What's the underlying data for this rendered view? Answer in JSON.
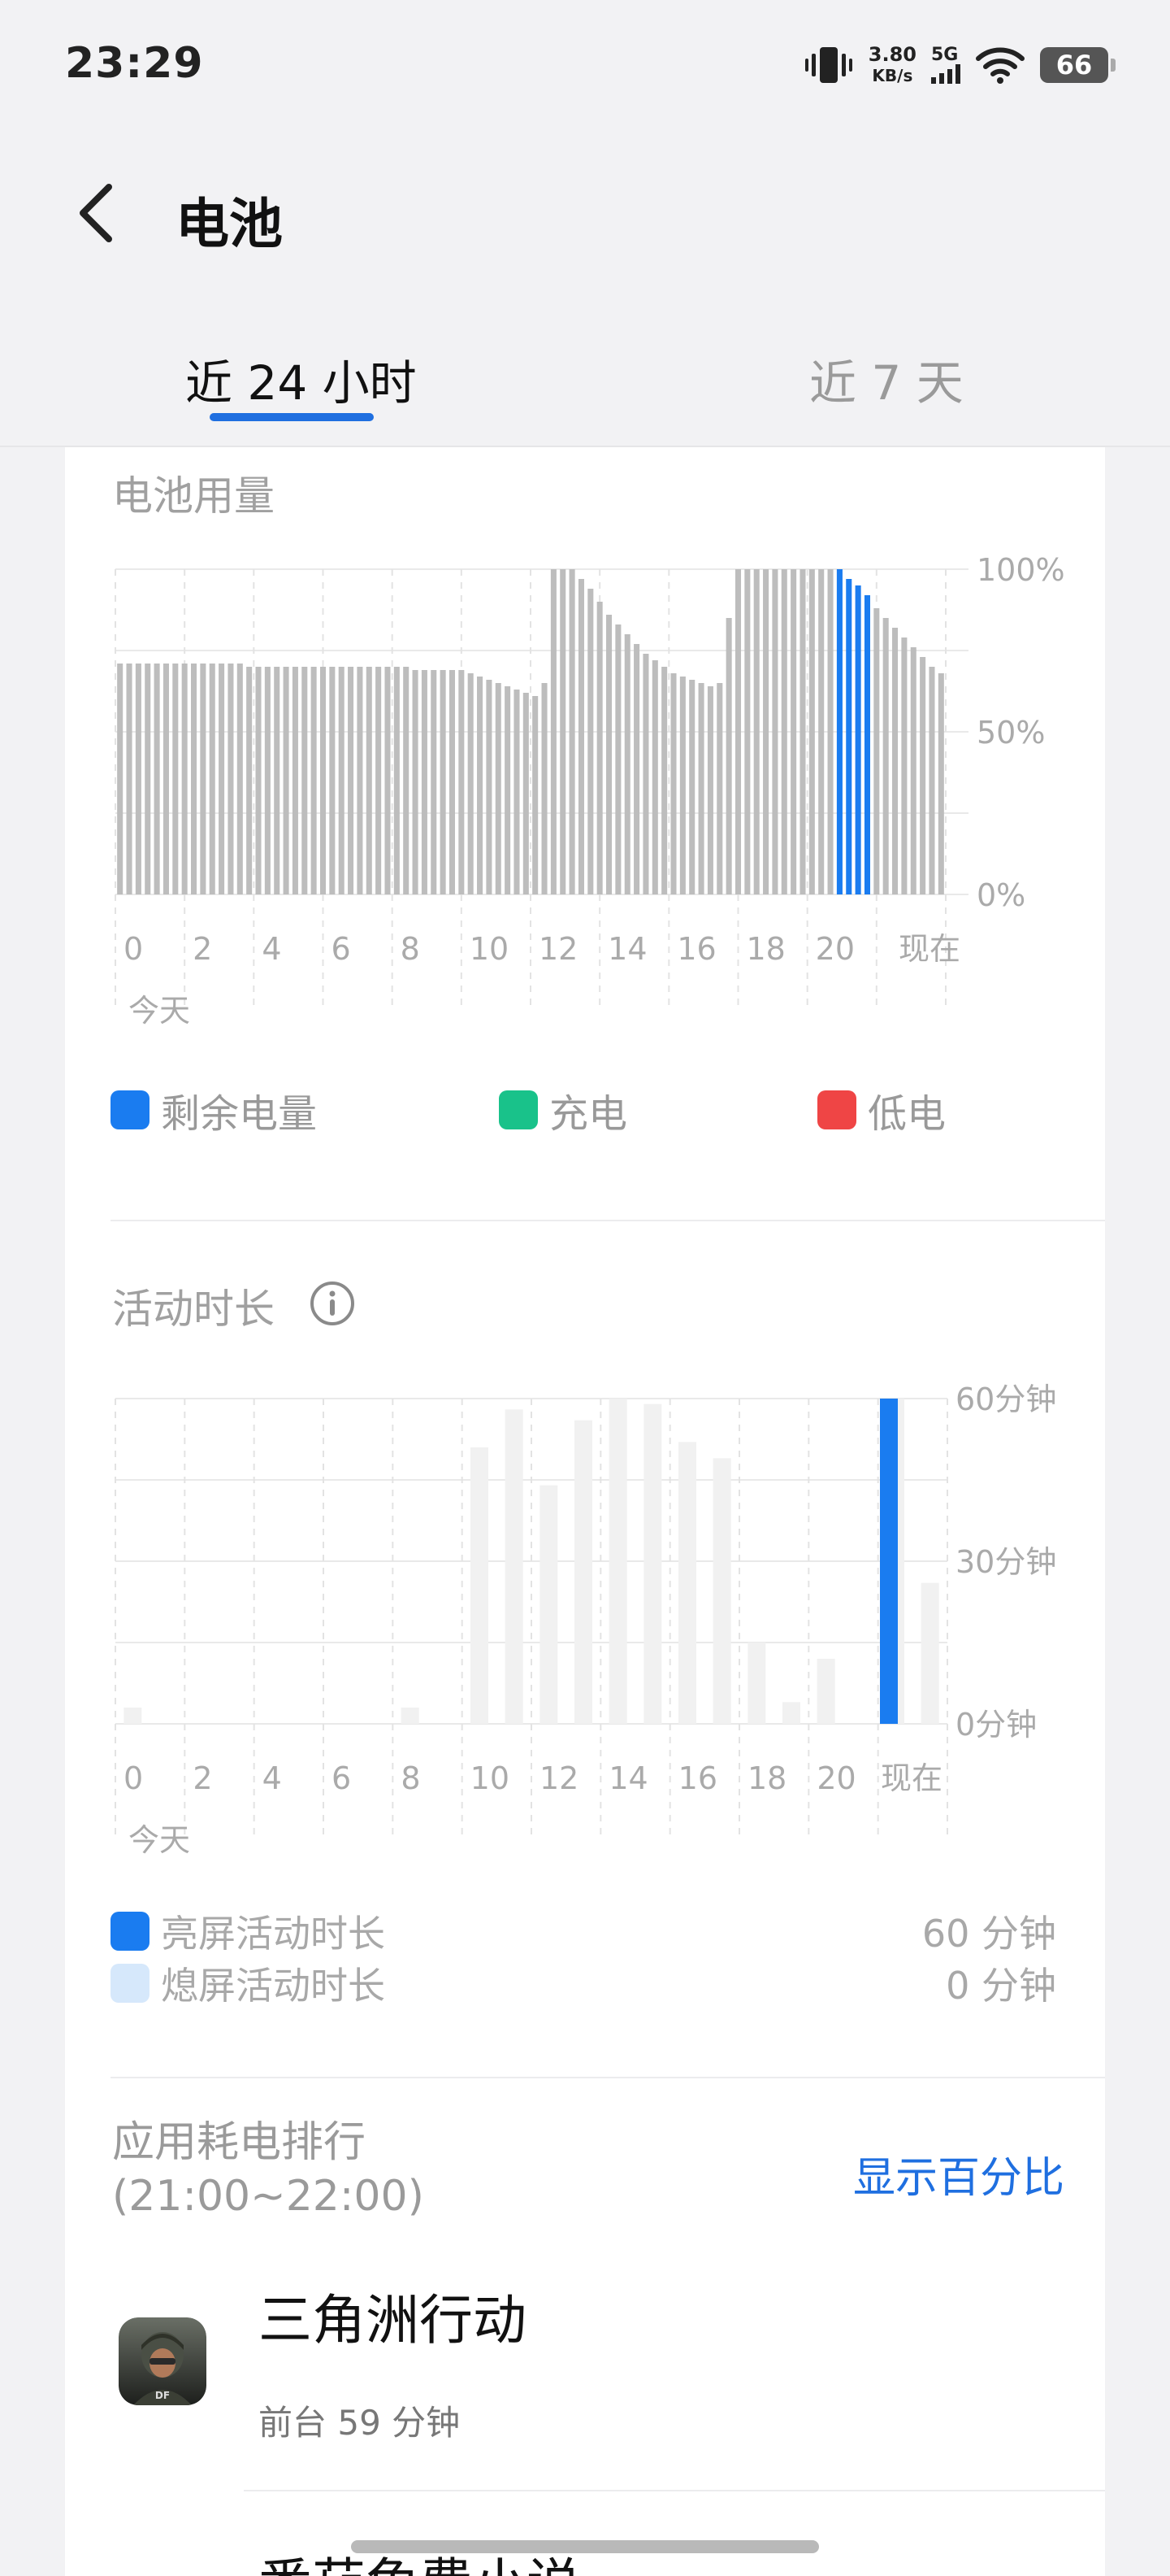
{
  "status_bar": {
    "time": "23:29",
    "net_speed_value": "3.80",
    "net_speed_unit": "KB/s",
    "network_type": "5G",
    "battery_level": "66"
  },
  "header": {
    "title": "电池"
  },
  "tabs": [
    {
      "label": "近 24 小时",
      "active": true
    },
    {
      "label": "近 7 天",
      "active": false
    }
  ],
  "battery_usage": {
    "title": "电池用量",
    "y_tick_labels": [
      "100%",
      "50%",
      "0%"
    ],
    "x_tick_labels": [
      "0",
      "2",
      "4",
      "6",
      "8",
      "10",
      "12",
      "14",
      "16",
      "18",
      "20",
      "现在"
    ],
    "day_label": "今天",
    "legend": [
      {
        "label": "剩余电量",
        "color": "#1a7cf0"
      },
      {
        "label": "充电",
        "color": "#19c28a"
      },
      {
        "label": "低电",
        "color": "#ef4545"
      }
    ]
  },
  "activity": {
    "title": "活动时长",
    "y_tick_labels": [
      "60分钟",
      "30分钟",
      "0分钟"
    ],
    "x_tick_labels": [
      "0",
      "2",
      "4",
      "6",
      "8",
      "10",
      "12",
      "14",
      "16",
      "18",
      "20",
      "现在"
    ],
    "day_label": "今天",
    "legend": [
      {
        "label": "亮屏活动时长",
        "value": "60 分钟",
        "color": "#1a7cf0"
      },
      {
        "label": "熄屏活动时长",
        "value": "0 分钟",
        "color": "#d6e8fb"
      }
    ]
  },
  "ranking": {
    "title_line1": "应用耗电排行",
    "title_line2": "(21:00~22:00)",
    "toggle_label": "显示百分比",
    "apps": [
      {
        "name": "三角洲行动",
        "detail": "前台 59 分钟"
      },
      {
        "name": "番茄免费小说",
        "detail": ""
      }
    ]
  },
  "chart_data": [
    {
      "type": "bar",
      "title": "电池用量",
      "ylabel": "",
      "xlabel": "",
      "ylim": [
        0,
        100
      ],
      "unit": "%",
      "x_ticks": [
        "0",
        "2",
        "4",
        "6",
        "8",
        "10",
        "12",
        "14",
        "16",
        "18",
        "20",
        "现在"
      ],
      "values": [
        71,
        71,
        71,
        71,
        71,
        71,
        71,
        71,
        71,
        71,
        71,
        71,
        71,
        71,
        70,
        70,
        70,
        70,
        70,
        70,
        70,
        70,
        70,
        70,
        70,
        70,
        70,
        70,
        70,
        70,
        70,
        70,
        69,
        69,
        69,
        69,
        69,
        69,
        68,
        67,
        66,
        65,
        64,
        63,
        62,
        61,
        65,
        100,
        100,
        100,
        97,
        94,
        90,
        86,
        83,
        80,
        77,
        74,
        72,
        70,
        68,
        67,
        66,
        65,
        64,
        65,
        85,
        100,
        100,
        100,
        100,
        100,
        100,
        100,
        100,
        100,
        100,
        100,
        100,
        97,
        95,
        92,
        88,
        85,
        82,
        79,
        76,
        73,
        70,
        68
      ],
      "highlight_range": [
        78,
        81
      ],
      "highlight_color": "#1a7cf0",
      "base_color": "#bdbdbd"
    },
    {
      "type": "bar",
      "title": "活动时长",
      "ylabel": "",
      "xlabel": "",
      "ylim": [
        0,
        60
      ],
      "unit": "分钟",
      "x_ticks": [
        "0",
        "2",
        "4",
        "6",
        "8",
        "10",
        "12",
        "14",
        "16",
        "18",
        "20",
        "现在"
      ],
      "series": [
        {
          "name": "亮屏活动时长",
          "values": [
            0,
            0,
            0,
            0,
            0,
            0,
            0,
            0,
            0,
            0,
            0,
            0,
            0,
            0,
            0,
            0,
            0,
            0,
            0,
            0,
            0,
            0,
            60,
            0
          ]
        },
        {
          "name": "熄屏活动时长",
          "values": [
            3,
            0,
            0,
            0,
            0,
            0,
            0,
            0,
            3,
            0,
            51,
            58,
            44,
            56,
            60,
            59,
            52,
            49,
            15,
            4,
            12,
            0,
            60,
            26
          ]
        }
      ]
    }
  ]
}
